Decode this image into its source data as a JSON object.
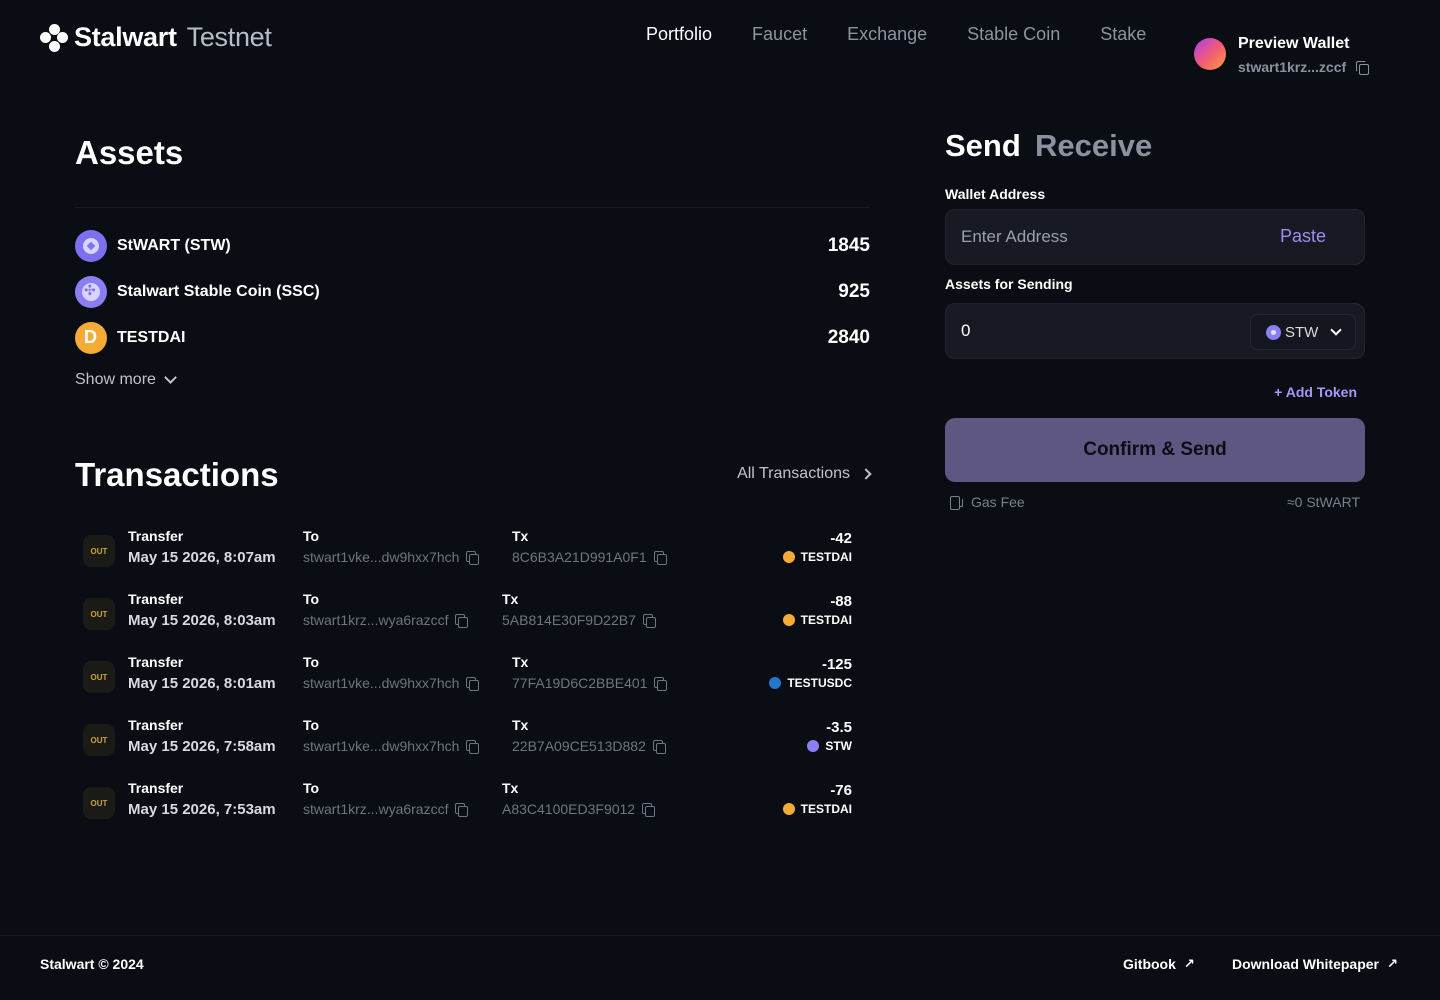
{
  "header": {
    "brand_name": "Stalwart",
    "brand_network": "Testnet",
    "nav": [
      {
        "label": "Portfolio",
        "active": true
      },
      {
        "label": "Faucet",
        "active": false
      },
      {
        "label": "Exchange",
        "active": false
      },
      {
        "label": "Stable Coin",
        "active": false
      },
      {
        "label": "Stake",
        "active": false
      }
    ],
    "wallet": {
      "name": "Preview Wallet",
      "address": "stwart1krz...zccf"
    }
  },
  "assets": {
    "title": "Assets",
    "items": [
      {
        "name": "StWART (STW)",
        "amount": "1845",
        "icon": "stw-token-icon"
      },
      {
        "name": "Stalwart Stable Coin (SSC)",
        "amount": "925",
        "icon": "ssc-token-icon"
      },
      {
        "name": "TESTDAI",
        "amount": "2840",
        "icon": "dai-token-icon"
      }
    ],
    "show_more": "Show more"
  },
  "transactions": {
    "title": "Transactions",
    "all_link": "All Transactions",
    "to_label": "To",
    "tx_label": "Tx",
    "rows": [
      {
        "badge": "OUT",
        "type": "Transfer",
        "date": "May 15 2026, 8:07am",
        "to": "stwart1vke...dw9hxx7hch",
        "tx": "8C6B3A21D991A0F1",
        "amount": "-42",
        "token": "TESTDAI",
        "token_color": "#f5ac37"
      },
      {
        "badge": "OUT",
        "type": "Transfer",
        "date": "May 15 2026, 8:03am",
        "to": "stwart1krz...wya6razccf",
        "tx": "5AB814E30F9D22B7",
        "amount": "-88",
        "token": "TESTDAI",
        "token_color": "#f5ac37"
      },
      {
        "badge": "OUT",
        "type": "Transfer",
        "date": "May 15 2026, 8:01am",
        "to": "stwart1vke...dw9hxx7hch",
        "tx": "77FA19D6C2BBE401",
        "amount": "-125",
        "token": "TESTUSDC",
        "token_color": "#2775ca"
      },
      {
        "badge": "OUT",
        "type": "Transfer",
        "date": "May 15 2026, 7:58am",
        "to": "stwart1vke...dw9hxx7hch",
        "tx": "22B7A09CE513D882",
        "amount": "-3.5",
        "token": "STW",
        "token_color": "#8c7ff5"
      },
      {
        "badge": "OUT",
        "type": "Transfer",
        "date": "May 15 2026, 7:53am",
        "to": "stwart1krz...wya6razccf",
        "tx": "A83C4100ED3F9012",
        "amount": "-76",
        "token": "TESTDAI",
        "token_color": "#f5ac37"
      }
    ]
  },
  "send_panel": {
    "tab_send": "Send",
    "tab_receive": "Receive",
    "wallet_address_label": "Wallet Address",
    "wallet_address_placeholder": "Enter Address",
    "paste_label": "Paste",
    "assets_label": "Assets for Sending",
    "amount_value": "0",
    "selected_token": "STW",
    "add_token": "+ Add Token",
    "confirm_label": "Confirm & Send",
    "gas_fee_label": "Gas Fee",
    "gas_fee_value": "≈0 StWART"
  },
  "footer": {
    "copyright": "Stalwart © 2024",
    "links": [
      "Gitbook",
      "Download Whitepaper"
    ]
  },
  "colors": {
    "background": "#0b0d14",
    "accent": "#9e8cf3",
    "button": "#5e5782"
  }
}
